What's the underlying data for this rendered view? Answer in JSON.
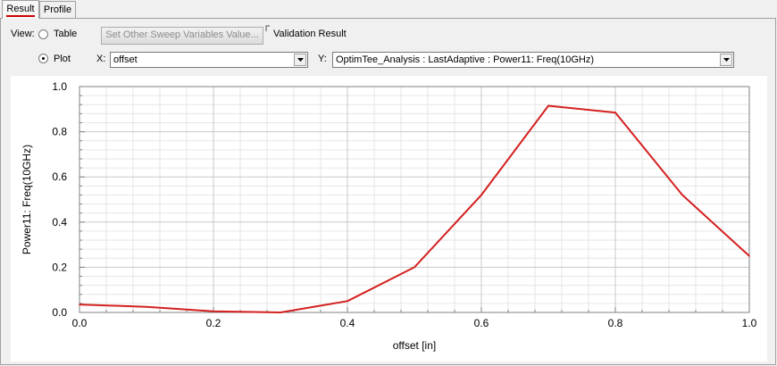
{
  "tabs": [
    {
      "label": "Result",
      "active": true
    },
    {
      "label": "Profile",
      "active": false
    }
  ],
  "view": {
    "label": "View:",
    "options": [
      {
        "label": "Table",
        "selected": false
      },
      {
        "label": "Plot",
        "selected": true
      }
    ]
  },
  "sweep_button": {
    "label": "Set Other Sweep Variables Value...",
    "enabled": false
  },
  "validation_label": "Validation Result",
  "x_select": {
    "label": "X:",
    "value": "offset"
  },
  "y_select": {
    "label": "Y:",
    "value": "OptimTee_Analysis : LastAdaptive : Power11: Freq(10GHz)"
  },
  "colors": {
    "trace": "#d42020",
    "grid_major": "#c8c8c8",
    "grid_minor": "#e6e6e6",
    "accent": "#d00000"
  },
  "icons": {
    "dropdown": "chevron-down-icon",
    "radio": "radio-icon"
  },
  "chart_data": {
    "type": "line",
    "xlabel": "offset [in]",
    "ylabel": "Power11: Freq(10GHz)",
    "xlim": [
      0,
      1
    ],
    "ylim": [
      0,
      1
    ],
    "xticks": [
      "0.0",
      "0.2",
      "0.4",
      "0.6",
      "0.8",
      "1.0"
    ],
    "yticks": [
      "0.0",
      "0.2",
      "0.4",
      "0.6",
      "0.8",
      "1.0"
    ],
    "grid": true,
    "series": [
      {
        "x": [
          0.0,
          0.1,
          0.2,
          0.3,
          0.4,
          0.5,
          0.6,
          0.7,
          0.8,
          0.9,
          1.0
        ],
        "values": [
          0.035,
          0.025,
          0.005,
          0.0,
          0.05,
          0.2,
          0.52,
          0.915,
          0.885,
          0.52,
          0.25
        ]
      }
    ]
  }
}
